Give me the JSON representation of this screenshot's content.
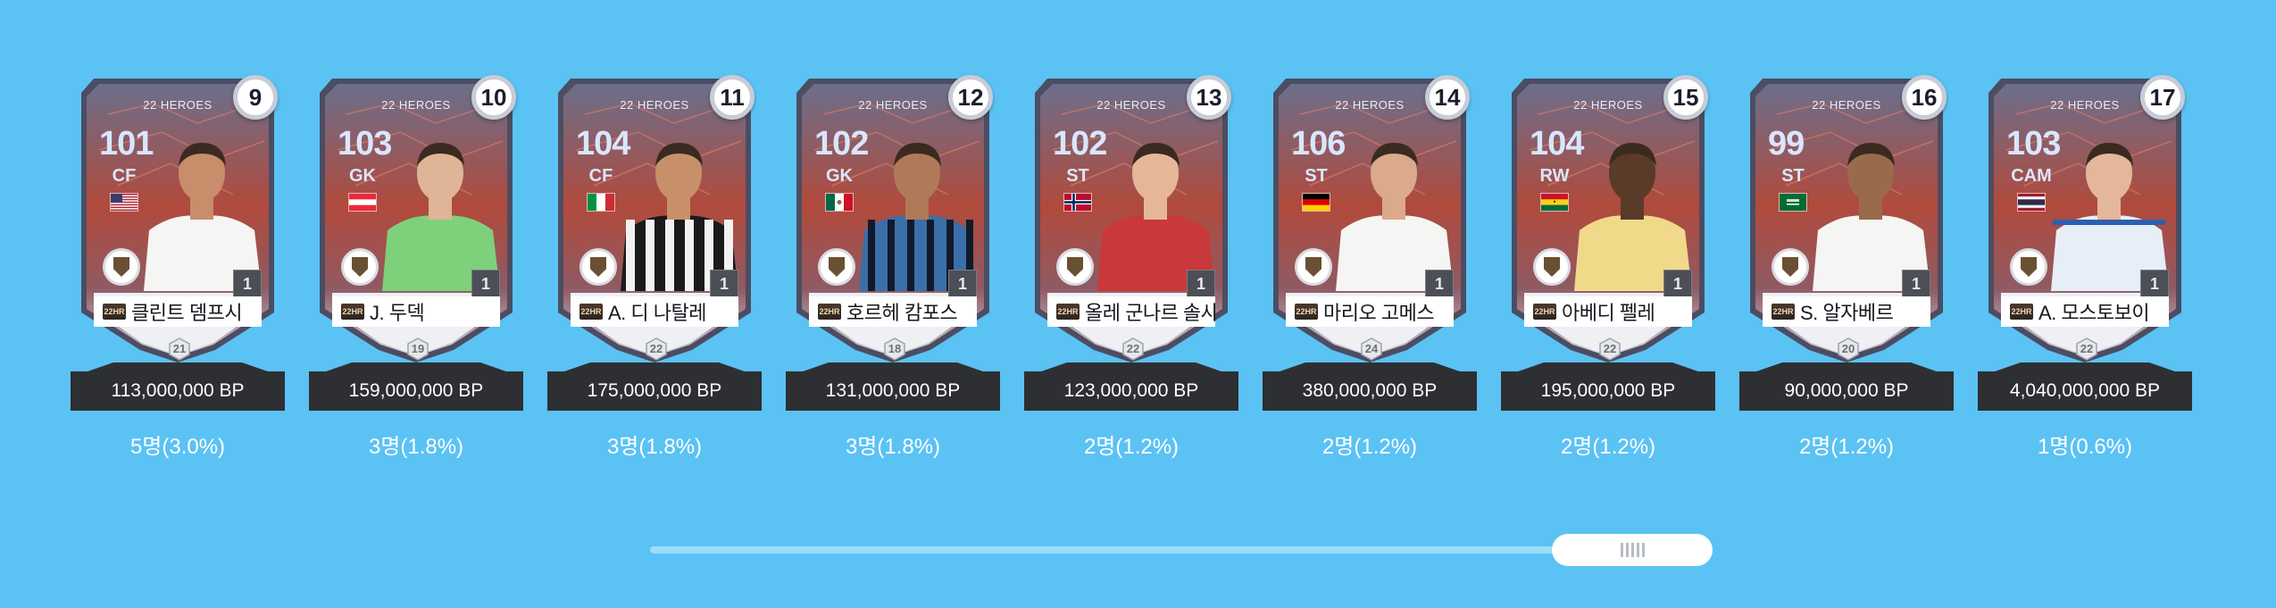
{
  "cards": [
    {
      "rank": "9",
      "season": "22 HEROES",
      "ovr": "101",
      "pos": "CF",
      "flag": "us",
      "name": "클린트 뎀프시",
      "salary": "21",
      "price": "113,000,000 BP",
      "count": "5명(3.0%)",
      "skin": "#c88d6b",
      "kit": "white",
      "chip": "22HR"
    },
    {
      "rank": "10",
      "season": "22 HEROES",
      "ovr": "103",
      "pos": "GK",
      "flag": "at",
      "name": "J. 두덱",
      "salary": "19",
      "price": "159,000,000 BP",
      "count": "3명(1.8%)",
      "skin": "#e0b497",
      "kit": "green",
      "chip": "22HR"
    },
    {
      "rank": "11",
      "season": "22 HEROES",
      "ovr": "104",
      "pos": "CF",
      "flag": "it",
      "name": "A. 디 나탈레",
      "salary": "22",
      "price": "175,000,000 BP",
      "count": "3명(1.8%)",
      "skin": "#c8906a",
      "kit": "stripes-bw",
      "chip": "22HR"
    },
    {
      "rank": "12",
      "season": "22 HEROES",
      "ovr": "102",
      "pos": "GK",
      "flag": "mx",
      "name": "호르헤 캄포스",
      "salary": "18",
      "price": "131,000,000 BP",
      "count": "3명(1.8%)",
      "skin": "#b07a58",
      "kit": "stripes-blue",
      "chip": "22HR"
    },
    {
      "rank": "13",
      "season": "22 HEROES",
      "ovr": "102",
      "pos": "ST",
      "flag": "no",
      "name": "올레 군나르 솔샤",
      "salary": "22",
      "price": "123,000,000 BP",
      "count": "2명(1.2%)",
      "skin": "#e6b699",
      "kit": "red",
      "chip": "22HR"
    },
    {
      "rank": "14",
      "season": "22 HEROES",
      "ovr": "106",
      "pos": "ST",
      "flag": "de",
      "name": "마리오 고메스",
      "salary": "24",
      "price": "380,000,000 BP",
      "count": "2명(1.2%)",
      "skin": "#dba98c",
      "kit": "white",
      "chip": "22HR"
    },
    {
      "rank": "15",
      "season": "22 HEROES",
      "ovr": "104",
      "pos": "RW",
      "flag": "gh",
      "name": "아베디 펠레",
      "salary": "22",
      "price": "195,000,000 BP",
      "count": "2명(1.2%)",
      "skin": "#5a3a28",
      "kit": "yellow",
      "chip": "22HR"
    },
    {
      "rank": "16",
      "season": "22 HEROES",
      "ovr": "99",
      "pos": "ST",
      "flag": "sa",
      "name": "S. 알자베르",
      "salary": "20",
      "price": "90,000,000 BP",
      "count": "2명(1.2%)",
      "skin": "#9a6a4c",
      "kit": "white",
      "chip": "22HR"
    },
    {
      "rank": "17",
      "season": "22 HEROES",
      "ovr": "103",
      "pos": "CAM",
      "flag": "th",
      "name": "A. 모스토보이",
      "salary": "22",
      "price": "4,040,000,000 BP",
      "count": "1명(0.6%)",
      "skin": "#e4b79b",
      "kit": "lightblue",
      "chip": "22HR"
    }
  ],
  "scrollbar": {
    "thumb_icon": "grip-icon",
    "position": 0.97
  },
  "colors": {
    "background": "#5bc2f4",
    "price_bar": "#2e2f33",
    "card_red": "#b5493c",
    "card_frame": "#6e6e8a"
  }
}
